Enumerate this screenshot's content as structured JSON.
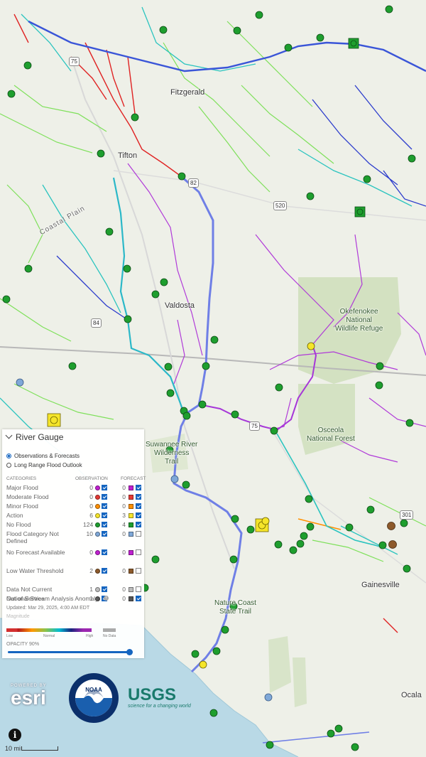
{
  "places": {
    "fitzgerald": "Fitzgerald",
    "tifton": "Tifton",
    "valdosta": "Valdosta",
    "gainesville": "Gainesville",
    "ocala": "Ocala",
    "coastal_plain": "Coastal Plain",
    "okefenokee": "Okefenokee\nNational\nWildlife Refuge",
    "osceola": "Osceola\nNational Forest",
    "suwannee": "Suwannee River\nWilderness\nTrail",
    "nature_coast": "Nature Coast\nState Trail"
  },
  "shields": {
    "i75_north": "75",
    "us82": "82",
    "ga520": "520",
    "us84": "84",
    "i75_south": "75",
    "us301": "301"
  },
  "legend": {
    "title": "River Gauge",
    "mode_options": [
      {
        "label": "Observations & Forecasts",
        "selected": true
      },
      {
        "label": "Long Range Flood Outlook",
        "selected": false
      }
    ],
    "col_categories": "CATEGORIES",
    "col_observation": "OBSERVATION",
    "col_forecast": "FORECAST",
    "rows": [
      {
        "label": "Major Flood",
        "obs_count": "0",
        "fc_count": "0",
        "color": "#c020d0",
        "obs_checked": true,
        "fc_checked": true
      },
      {
        "label": "Moderate Flood",
        "obs_count": "0",
        "fc_count": "0",
        "color": "#e53935",
        "obs_checked": true,
        "fc_checked": true
      },
      {
        "label": "Minor Flood",
        "obs_count": "0",
        "fc_count": "0",
        "color": "#ff8f00",
        "obs_checked": true,
        "fc_checked": true
      },
      {
        "label": "Action",
        "obs_count": "6",
        "fc_count": "3",
        "color": "#f5e52a",
        "obs_checked": true,
        "fc_checked": true
      },
      {
        "label": "No Flood",
        "obs_count": "124",
        "fc_count": "4",
        "color": "#1e9e2e",
        "obs_checked": true,
        "fc_checked": true
      },
      {
        "label": "Flood Category Not Defined",
        "obs_count": "10",
        "fc_count": "0",
        "color": "#7fa8d8",
        "obs_checked": true,
        "fc_checked": false
      },
      {
        "label": "No Forecast Available",
        "obs_count": "0",
        "fc_count": "0",
        "color": "#c020d0",
        "obs_checked": true,
        "fc_checked": false
      },
      {
        "label": "Low Water Threshold",
        "obs_count": "2",
        "fc_count": "0",
        "color": "#8d5a2b",
        "obs_checked": true,
        "fc_checked": false
      },
      {
        "label": "Data Not Current",
        "obs_count": "1",
        "fc_count": "0",
        "color": "#bdbdbd",
        "obs_checked": true,
        "fc_checked": false
      },
      {
        "label": "Out of Service",
        "obs_count": "1",
        "fc_count": "0",
        "color": "#555555",
        "obs_checked": true,
        "fc_checked": false
      }
    ],
    "anomaly_label": "National Stream Analysis Anomaly",
    "anomaly_checked": true,
    "updated": "Updated: Mar 29, 2025, 4:00 AM EDT",
    "magnitude": "Magnitude",
    "scale_low": "Low",
    "scale_normal": "Normal",
    "scale_high": "High",
    "scale_nodata": "No Data",
    "opacity_label": "OPACITY 90%",
    "opacity_value": 0.9
  },
  "logos": {
    "esri_top": "POWERED BY",
    "esri": "esri",
    "noaa": "NOAA",
    "usgs": "USGS",
    "usgs_tag": "science for a changing world"
  },
  "scale": "10 mi",
  "info_icon": "info-icon",
  "colors": {
    "major_river": "#3a55d8",
    "main_river_cyan": "#2bb8c8",
    "gauge_green": "#1e9e2e",
    "gauge_yellow": "#f5e52a"
  }
}
